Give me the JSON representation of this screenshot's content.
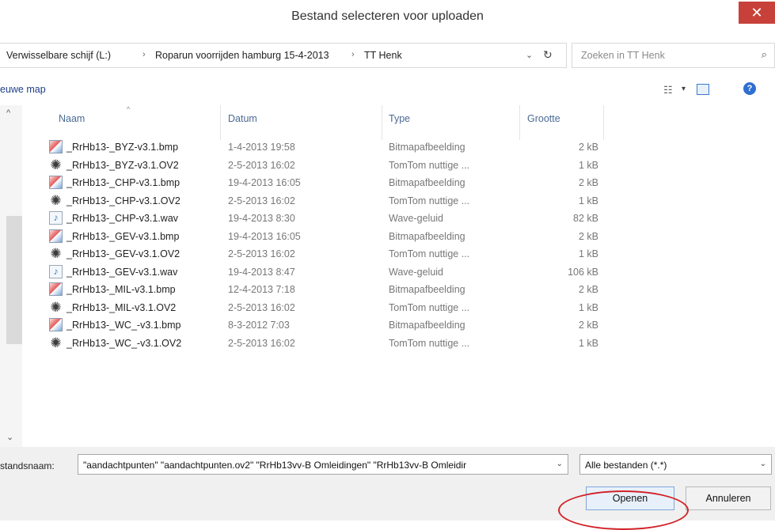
{
  "dialog": {
    "title": "Bestand selecteren voor uploaden",
    "close_label": "✕"
  },
  "address": {
    "crumbs": [
      "Verwisselbare schijf (L:)",
      "Roparun voorrijden hamburg 15-4-2013",
      "TT Henk"
    ],
    "separator": "›",
    "dropdown_glyph": "⌄",
    "refresh_glyph": "↻"
  },
  "search": {
    "placeholder": "Zoeken in TT Henk",
    "icon_glyph": "⌕"
  },
  "toolbar": {
    "new_folder_label": "euwe map",
    "view_glyph": "☷",
    "view_dd_glyph": "▾",
    "help_glyph": "?"
  },
  "list": {
    "columns": {
      "name": "Naam",
      "date": "Datum",
      "type": "Type",
      "size": "Grootte"
    },
    "sort_glyph": "^",
    "scroll_up_glyph": "^",
    "scroll_down_glyph": "⌄",
    "files": [
      {
        "name": "_RrHb13-_BYZ-v3.1.bmp",
        "date": "1-4-2013 19:58",
        "type": "Bitmapafbeelding",
        "size": "2 kB",
        "icon": "bmp-file-icon"
      },
      {
        "name": "_RrHb13-_BYZ-v3.1.OV2",
        "date": "2-5-2013 16:02",
        "type": "TomTom nuttige ...",
        "size": "1 kB",
        "icon": "ov2-file-icon"
      },
      {
        "name": "_RrHb13-_CHP-v3.1.bmp",
        "date": "19-4-2013 16:05",
        "type": "Bitmapafbeelding",
        "size": "2 kB",
        "icon": "bmp-file-icon"
      },
      {
        "name": "_RrHb13-_CHP-v3.1.OV2",
        "date": "2-5-2013 16:02",
        "type": "TomTom nuttige ...",
        "size": "1 kB",
        "icon": "ov2-file-icon"
      },
      {
        "name": "_RrHb13-_CHP-v3.1.wav",
        "date": "19-4-2013 8:30",
        "type": "Wave-geluid",
        "size": "82 kB",
        "icon": "wav-file-icon"
      },
      {
        "name": "_RrHb13-_GEV-v3.1.bmp",
        "date": "19-4-2013 16:05",
        "type": "Bitmapafbeelding",
        "size": "2 kB",
        "icon": "bmp-file-icon"
      },
      {
        "name": "_RrHb13-_GEV-v3.1.OV2",
        "date": "2-5-2013 16:02",
        "type": "TomTom nuttige ...",
        "size": "1 kB",
        "icon": "ov2-file-icon"
      },
      {
        "name": "_RrHb13-_GEV-v3.1.wav",
        "date": "19-4-2013 8:47",
        "type": "Wave-geluid",
        "size": "106 kB",
        "icon": "wav-file-icon"
      },
      {
        "name": "_RrHb13-_MIL-v3.1.bmp",
        "date": "12-4-2013 7:18",
        "type": "Bitmapafbeelding",
        "size": "2 kB",
        "icon": "bmp-file-icon"
      },
      {
        "name": "_RrHb13-_MIL-v3.1.OV2",
        "date": "2-5-2013 16:02",
        "type": "TomTom nuttige ...",
        "size": "1 kB",
        "icon": "ov2-file-icon"
      },
      {
        "name": "_RrHb13-_WC_-v3.1.bmp",
        "date": "8-3-2012 7:03",
        "type": "Bitmapafbeelding",
        "size": "2 kB",
        "icon": "bmp-file-icon"
      },
      {
        "name": "_RrHb13-_WC_-v3.1.OV2",
        "date": "2-5-2013 16:02",
        "type": "TomTom nuttige ...",
        "size": "1 kB",
        "icon": "ov2-file-icon"
      }
    ]
  },
  "footer": {
    "filename_label": "standsnaam:",
    "filename_value": "\"aandachtpunten\" \"aandachtpunten.ov2\" \"RrHb13vv-B Omleidingen\" \"RrHb13vv-B Omleidir",
    "filter_value": "Alle bestanden (*.*)",
    "dropdown_glyph": "⌄",
    "open_label": "Openen",
    "cancel_label": "Annuleren"
  },
  "colors": {
    "close": "#c7413a",
    "annotation": "#d2232a",
    "accent": "#2f6fd1"
  }
}
